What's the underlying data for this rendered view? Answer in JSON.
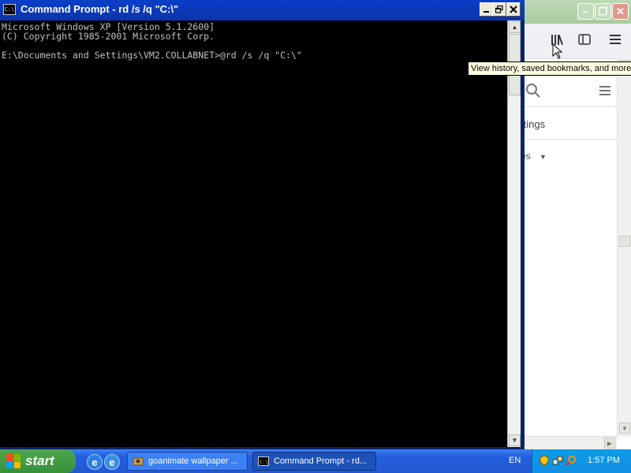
{
  "cmd": {
    "title": "Command Prompt - rd /s /q \"C:\\\"",
    "icon_label": "C:\\",
    "lines": [
      "Microsoft Windows XP [Version 5.1.2600]",
      "(C) Copyright 1985-2001 Microsoft Corp.",
      "",
      "E:\\Documents and Settings\\VM2.COLLABNET>@rd /s /q \"C:\\\""
    ]
  },
  "browser": {
    "tooltip": "View history, saved bookmarks, and more",
    "settings_partial": "ttings",
    "dropdown_partial": "es"
  },
  "taskbar": {
    "start_label": "start",
    "tasks": [
      {
        "label": "goanimate wallpaper ..."
      },
      {
        "label": "Command Prompt - rd..."
      }
    ],
    "language": "EN",
    "clock": "1:57 PM"
  },
  "colors": {
    "console_bg": "#000000",
    "console_text": "#c0c0c0",
    "title_bar": "#0a3fc9",
    "taskbar": "#245edc",
    "start_button": "#37903a"
  },
  "icons": {
    "browser_library": "library-icon",
    "browser_sidebar": "sidebar-icon",
    "browser_menu": "hamburger-menu-icon",
    "search": "search-icon"
  }
}
